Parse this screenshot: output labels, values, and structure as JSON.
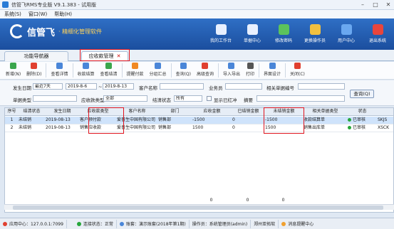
{
  "window": {
    "title": "信管飞RMS专业版 V9.1.383 - 试用版",
    "controls": [
      "–",
      "□",
      "✕"
    ]
  },
  "menu": [
    "系统(S)",
    "窗口(W)",
    "帮助(H)"
  ],
  "brand": {
    "name": "信管飞",
    "tagline": "· 精细化管理软件"
  },
  "nav": [
    {
      "label": "我的工作台",
      "icon": "monitor-icon",
      "color": "#e8f0ff"
    },
    {
      "label": "单据中心",
      "icon": "document-list-icon",
      "color": "#e8f0ff"
    },
    {
      "label": "修改密码",
      "icon": "key-icon",
      "color": "#5cc35c"
    },
    {
      "label": "更换操作员",
      "icon": "user-switch-icon",
      "color": "#f0c040"
    },
    {
      "label": "用户中心",
      "icon": "user-icon",
      "color": "#6aa8f0"
    },
    {
      "label": "退出系统",
      "icon": "power-icon",
      "color": "#e8453c"
    }
  ],
  "tabs": {
    "home": "功能导航器",
    "active": "应收款管理"
  },
  "toolbar": [
    {
      "label": "新增(N)",
      "icon": "add-icon",
      "color": "#3aa64c"
    },
    {
      "label": "删除(D)",
      "icon": "delete-icon",
      "color": "#e04030"
    },
    {
      "label": "查看详情",
      "icon": "view-icon",
      "color": "#4a86d8"
    },
    {
      "label": "收款结算",
      "icon": "receive-icon",
      "color": "#4a86d8"
    },
    {
      "label": "查看结清",
      "icon": "settled-icon",
      "color": "#3aa64c"
    },
    {
      "label": "提醒付款",
      "icon": "reminder-icon",
      "color": "#f08a24"
    },
    {
      "label": "分组汇总",
      "icon": "group-icon",
      "color": "#4a86d8"
    },
    {
      "label": "查询(Q)",
      "icon": "query-icon",
      "color": "#4a86d8"
    },
    {
      "label": "高级查询",
      "icon": "advanced-query-icon",
      "color": "#e04030"
    },
    {
      "label": "导入导出",
      "icon": "import-export-icon",
      "color": "#4a86d8"
    },
    {
      "label": "打印",
      "icon": "print-icon",
      "color": "#555555"
    },
    {
      "label": "界面设计",
      "icon": "design-icon",
      "color": "#4a86d8"
    },
    {
      "label": "关闭(C)",
      "icon": "close-icon",
      "color": "#e04030"
    }
  ],
  "filters": {
    "date_label": "发生日期",
    "date_range": "最近7天",
    "date_from": "2019-8-6",
    "to_label": "~",
    "date_to": "2019-8-13",
    "customer_label": "客户名称",
    "customer_value": "",
    "salesman_label": "业务员",
    "salesman_value": "",
    "related_no_label": "相关单据编号",
    "related_no_value": "",
    "bill_type_label": "单据类型",
    "bill_type_value": "",
    "recv_type_label": "应收款类型",
    "recv_type_value": "全部",
    "settle_label": "结清状态",
    "settle_value": "所有",
    "show_red_label": "显示已红冲",
    "summary_label": "摘要",
    "summary_value": "",
    "query_button": "查询(Q)"
  },
  "table": {
    "columns": [
      "序号",
      "结清状态",
      "发生日期",
      "应收款类型",
      "客户名称",
      "部门",
      "应收金额",
      "已结销金额",
      "未结销金额",
      "相关单据类型",
      "状态",
      ""
    ],
    "rows": [
      [
        "1",
        "未结销",
        "2019-08-13",
        "客户预付款",
        "爱普生中国有限公司",
        "销售部",
        "-1500",
        "0",
        "-1500",
        "收款结算单",
        "已审核",
        "SKJS"
      ],
      [
        "2",
        "未结销",
        "2019-08-13",
        "销售应收款",
        "爱普生中国有限公司",
        "销售部",
        "1500",
        "0",
        "1500",
        "销售出库单",
        "已审核",
        "XSCK"
      ]
    ],
    "totals": [
      "0",
      "0",
      "0"
    ]
  },
  "statusbar": {
    "server": "应用中心：127.0.0.1:7099",
    "connection": "连接状态：正常",
    "account": "账套：演示账套(2018年第1期)",
    "operator": "操作员：系统管理员(admin)",
    "company": "郑州亚拓软",
    "messages": "消息提醒中心"
  }
}
